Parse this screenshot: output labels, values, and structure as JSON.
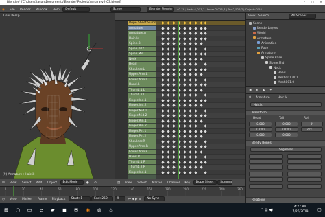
{
  "window": {
    "title": "Blender* [C:\\Users\\jason\\Documents\\Blender\\Projects\\amara-v2-03.blend]"
  },
  "menubar": {
    "items": [
      "File",
      "Render",
      "Window",
      "Help"
    ],
    "layout": "Default",
    "scene_tab": "Scene",
    "engine": "Blender Render",
    "stats": "v2.79 | Verts:1,013,7 | Faces:2,026,7 | Tris:2,526,7 | Objects:0/54 | L"
  },
  "viewport": {
    "label": "User Persp",
    "status": "(9) Armature : Hair.ik",
    "header": [
      "View",
      "Select",
      "Add",
      "Object"
    ],
    "mode": "Edit Mode"
  },
  "dopesheet": {
    "channels": [
      {
        "label": "Dope Sheet Summar",
        "kind": "sum"
      },
      {
        "label": "Armature",
        "kind": "obj"
      },
      {
        "label": "Armature.A",
        "kind": "grp"
      },
      {
        "label": "Hair.ik",
        "kind": "grp"
      },
      {
        "label": "Spine.B",
        "kind": "grp"
      },
      {
        "label": "Spine.002",
        "kind": "grp"
      },
      {
        "label": "Spine.Mid",
        "kind": "grp"
      },
      {
        "label": "Neck",
        "kind": "grp"
      },
      {
        "label": "Head",
        "kind": "grp"
      },
      {
        "label": "Shoulder.L",
        "kind": "grp"
      },
      {
        "label": "Upper.Arm.L",
        "kind": "grp"
      },
      {
        "label": "Lower.Arm.L",
        "kind": "grp"
      },
      {
        "label": "Hand.L",
        "kind": "grp"
      },
      {
        "label": "Thumb.1.L",
        "kind": "grp"
      },
      {
        "label": "Thumb.2.L",
        "kind": "grp"
      },
      {
        "label": "Finger.Ind.1",
        "kind": "grp"
      },
      {
        "label": "Finger.Ind.2",
        "kind": "grp"
      },
      {
        "label": "Finger.Mid.1",
        "kind": "grp"
      },
      {
        "label": "Finger.Mid.2",
        "kind": "grp"
      },
      {
        "label": "Finger.Rin.1",
        "kind": "grp"
      },
      {
        "label": "Finger.Rin.2",
        "kind": "grp"
      },
      {
        "label": "Finger.Pin.1",
        "kind": "grp"
      },
      {
        "label": "Finger.Pin.2",
        "kind": "grp"
      },
      {
        "label": "Shoulder.R",
        "kind": "grp"
      },
      {
        "label": "Upper.Arm.R",
        "kind": "grp"
      },
      {
        "label": "Lower.Arm.R",
        "kind": "grp"
      },
      {
        "label": "Hand.R",
        "kind": "grp"
      },
      {
        "label": "Thumb.1.R",
        "kind": "grp"
      },
      {
        "label": "Thumb.2.R",
        "kind": "grp"
      },
      {
        "label": "Finger.Ind.1",
        "kind": "grp"
      }
    ],
    "header": [
      "View",
      "Select",
      "Marker",
      "Channel",
      "Key"
    ],
    "mode": "Dope Sheet",
    "summary": "Summa"
  },
  "outliner": {
    "header": [
      "View",
      "Search",
      "All Scenes"
    ],
    "items": [
      {
        "label": "Scene",
        "depth": 0,
        "color": "#b8b8b8"
      },
      {
        "label": "RenderLayers",
        "depth": 1,
        "color": "#8aa0c8"
      },
      {
        "label": "World",
        "depth": 1,
        "color": "#c86a4a"
      },
      {
        "label": "Armature",
        "depth": 1,
        "color": "#e0a040"
      },
      {
        "label": "Animation",
        "depth": 2,
        "color": "#7aa0d8"
      },
      {
        "label": "Pose",
        "depth": 2,
        "color": "#5aa0b8"
      },
      {
        "label": "Armature",
        "depth": 2,
        "color": "#e0a040"
      },
      {
        "label": "Spine.Base",
        "depth": 3,
        "color": "#cfcfcf"
      },
      {
        "label": "Spine.Mid",
        "depth": 4,
        "color": "#cfcfcf"
      },
      {
        "label": "Neck",
        "depth": 5,
        "color": "#cfcfcf"
      },
      {
        "label": "Head",
        "depth": 6,
        "color": "#cfcfcf"
      },
      {
        "label": "Mesh001.001",
        "depth": 6,
        "color": "#cfcfcf"
      },
      {
        "label": "Mesh001.0",
        "depth": 6,
        "color": "#cfcfcf"
      }
    ]
  },
  "properties": {
    "breadcrumb": [
      "Armature",
      "Hair.ik"
    ],
    "name_field": "Hair.ik",
    "transform": {
      "title": "Transform",
      "cols": [
        "Head",
        "Tail",
        "Roll"
      ],
      "x": "0.000",
      "y": "0.000",
      "z": "0.000",
      "roll": "0°",
      "lock": "Lock"
    },
    "bendy": {
      "title": "Bendy Bones",
      "segments": "Segments"
    },
    "relations": "Relations"
  },
  "timeline": {
    "ticks": [
      "0",
      "20",
      "40",
      "60",
      "80",
      "100",
      "120",
      "140",
      "160",
      "180",
      "200",
      "220",
      "240",
      "260"
    ],
    "header": [
      "View",
      "Marker",
      "Frame",
      "Playback"
    ],
    "start": "Start: 1",
    "end": "End: 250",
    "frame": "9",
    "sync": "No Sync"
  },
  "taskbar": {
    "time": "4:27 PM",
    "date": "7/26/2019"
  }
}
